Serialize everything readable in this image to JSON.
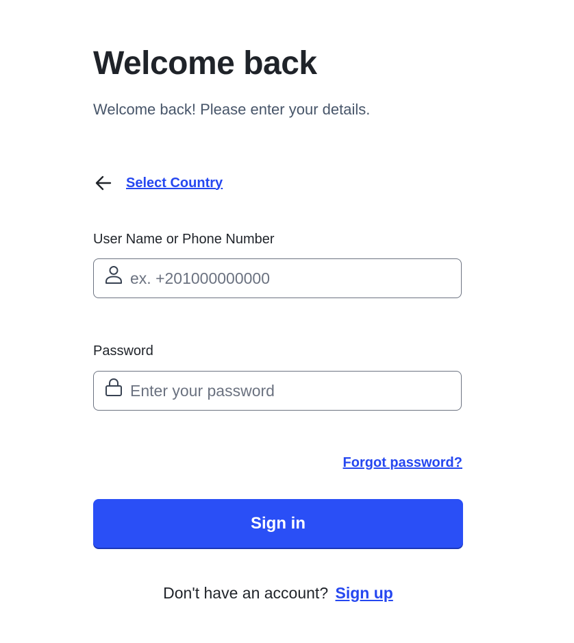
{
  "header": {
    "title": "Welcome back",
    "subtitle": "Welcome back! Please enter your details."
  },
  "back": {
    "icon": "arrow-left-icon",
    "label": "Select Country"
  },
  "username": {
    "label": "User Name or Phone Number",
    "placeholder": "ex. +201000000000",
    "value": "",
    "icon": "user-icon"
  },
  "password": {
    "label": "Password",
    "placeholder": "Enter your password",
    "value": "",
    "icon": "lock-icon"
  },
  "forgot_label": "Forgot password?",
  "signin_label": "Sign in",
  "signup": {
    "prompt": "Don't have an account?",
    "link": "Sign up"
  },
  "colors": {
    "accent": "#2a4ff6",
    "link": "#2547f0",
    "text": "#1f2329",
    "muted": "#475569"
  }
}
